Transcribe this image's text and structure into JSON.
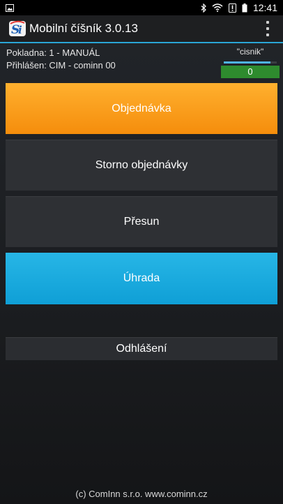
{
  "status_bar": {
    "time": "12:41",
    "icons": [
      "image-icon",
      "bluetooth-icon",
      "wifi-icon",
      "alert-icon",
      "battery-icon"
    ]
  },
  "action_bar": {
    "title": "Mobilní číšník 3.0.13",
    "logo_icon": "app-logo-icon",
    "menu_icon": "overflow-menu-icon"
  },
  "info": {
    "register": "Pokladna: 1 - MANUÁL",
    "logged_in": "Přihlášen: CIM - cominn 00"
  },
  "user": {
    "name": "\"cisnik\"",
    "counter": "0",
    "progress": 0.88
  },
  "buttons": {
    "order": "Objednávka",
    "cancel_order": "Storno objednávky",
    "move": "Přesun",
    "payment": "Úhrada",
    "logout": "Odhlášení"
  },
  "colors": {
    "accent": "#2aa6d6",
    "order": "#f7941d",
    "payment": "#1aa9dd",
    "counter": "#2e8b2e"
  },
  "footer": {
    "text": "(c) ComInn s.r.o. www.cominn.cz"
  }
}
